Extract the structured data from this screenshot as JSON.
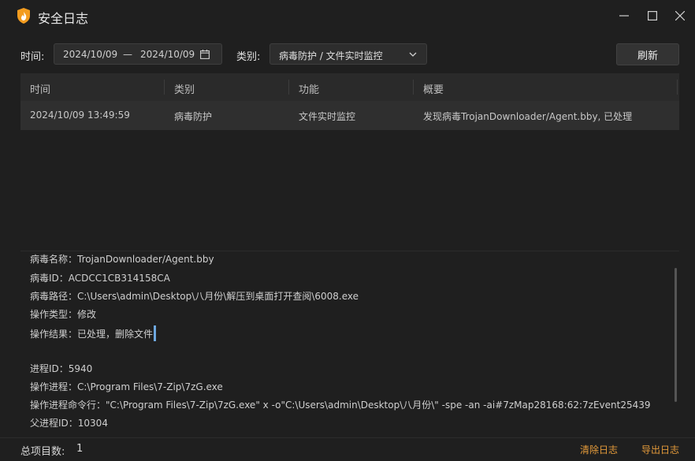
{
  "window": {
    "title": "安全日志"
  },
  "filters": {
    "time_label": "时间:",
    "date_from": "2024/10/09",
    "date_separator": "—",
    "date_to": "2024/10/09",
    "category_label": "类别:",
    "category_value": "病毒防护 / 文件实时监控",
    "refresh_label": "刷新"
  },
  "table": {
    "headers": [
      "时间",
      "类别",
      "功能",
      "概要"
    ],
    "rows": [
      [
        "2024/10/09 13:49:59",
        "病毒防护",
        "文件实时监控",
        "发现病毒TrojanDownloader/Agent.bby, 已处理"
      ]
    ]
  },
  "detail": {
    "lines": [
      "病毒名称：TrojanDownloader/Agent.bby",
      "病毒ID：ACDCC1CB314158CA",
      "病毒路径：C:\\Users\\admin\\Desktop\\八月份\\解压到桌面打开查阅\\6008.exe",
      "操作类型：修改",
      "操作结果：已处理，删除文件",
      "",
      "进程ID：5940",
      "操作进程：C:\\Program Files\\7-Zip\\7zG.exe",
      "操作进程命令行：\"C:\\Program Files\\7-Zip\\7zG.exe\" x -o\"C:\\Users\\admin\\Desktop\\八月份\\\" -spe -an -ai#7zMap28168:62:7zEvent25439",
      "父进程ID：10304"
    ]
  },
  "footer": {
    "total_label": "总项目数:",
    "total_count": "1",
    "clear_label": "清除日志",
    "export_label": "导出日志"
  },
  "colors": {
    "background": "#1f1f1f",
    "accent_link": "#e39a3a",
    "caret": "#6ea8e0",
    "icon_orange": "#f39c1f"
  },
  "icons": [
    "shield-flame-icon",
    "minimize-icon",
    "maximize-icon",
    "close-icon",
    "calendar-icon",
    "chevron-down-icon"
  ]
}
